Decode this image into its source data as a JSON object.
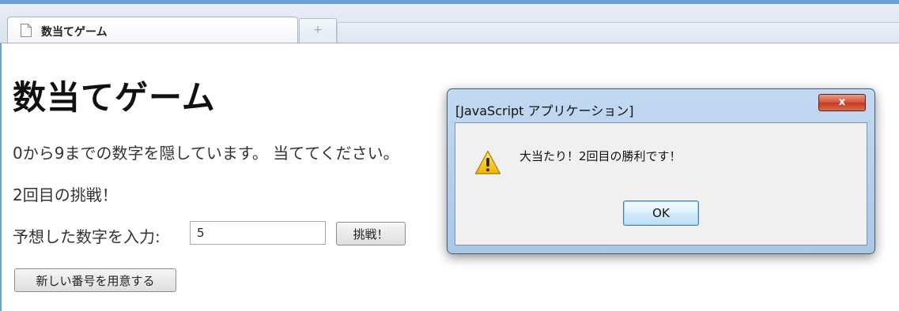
{
  "browser": {
    "tab_title": "数当てゲーム",
    "new_tab_symbol": "+"
  },
  "page": {
    "title": "数当てゲーム",
    "intro": "0から9までの数字を隠しています。 当ててください。",
    "attempt": "2回目の挑戦！",
    "input_label": "予想した数字を入力:",
    "input_value": "5",
    "challenge_button": "挑戦！",
    "new_number_button": "新しい番号を用意する"
  },
  "dialog": {
    "title": "[JavaScript アプリケーション]",
    "close_symbol": "x",
    "message": "大当たり！2回目の勝利です！",
    "ok_button": "OK",
    "icon": "warning-icon"
  },
  "colors": {
    "frame_accent": "#6aa0d8",
    "dialog_frame": "#b6d0ec",
    "close_button": "#c94b33"
  }
}
